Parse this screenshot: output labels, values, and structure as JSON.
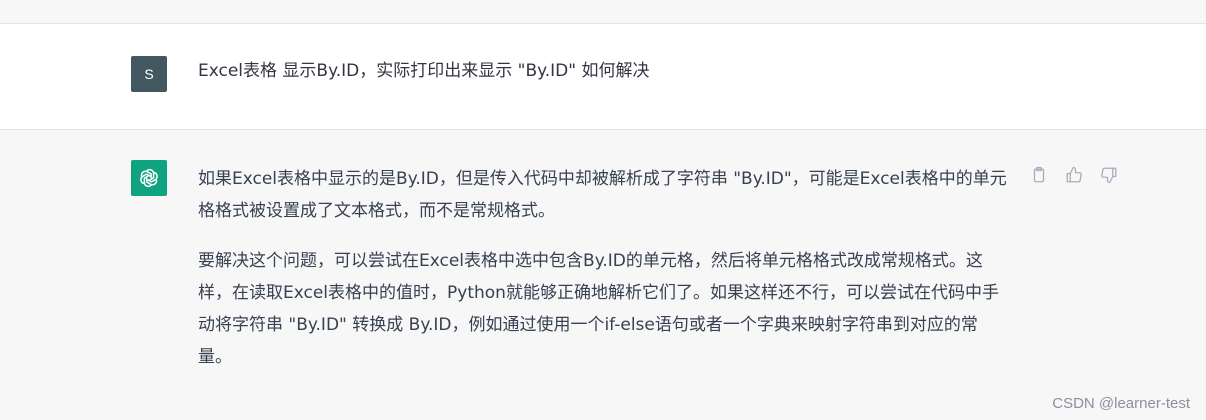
{
  "conversation": {
    "user": {
      "avatar_initial": "S",
      "message": "Excel表格 显示By.ID，实际打印出来显示 \"By.ID\" 如何解决"
    },
    "assistant": {
      "avatar_icon": "openai-logo-icon",
      "paragraphs": [
        "如果Excel表格中显示的是By.ID，但是传入代码中却被解析成了字符串 \"By.ID\"，可能是Excel表格中的单元格格式被设置成了文本格式，而不是常规格式。",
        "要解决这个问题，可以尝试在Excel表格中选中包含By.ID的单元格，然后将单元格格式改成常规格式。这样，在读取Excel表格中的值时，Python就能够正确地解析它们了。如果这样还不行，可以尝试在代码中手动将字符串 \"By.ID\" 转换成 By.ID，例如通过使用一个if-else语句或者一个字典来映射字符串到对应的常量。"
      ],
      "actions": [
        "clipboard-icon",
        "thumbs-up-icon",
        "thumbs-down-icon"
      ]
    }
  },
  "watermark": "CSDN @learner-test",
  "colors": {
    "user_avatar": "#435761",
    "assistant_avatar": "#10a37f",
    "assistant_bg": "#f7f7f8"
  }
}
